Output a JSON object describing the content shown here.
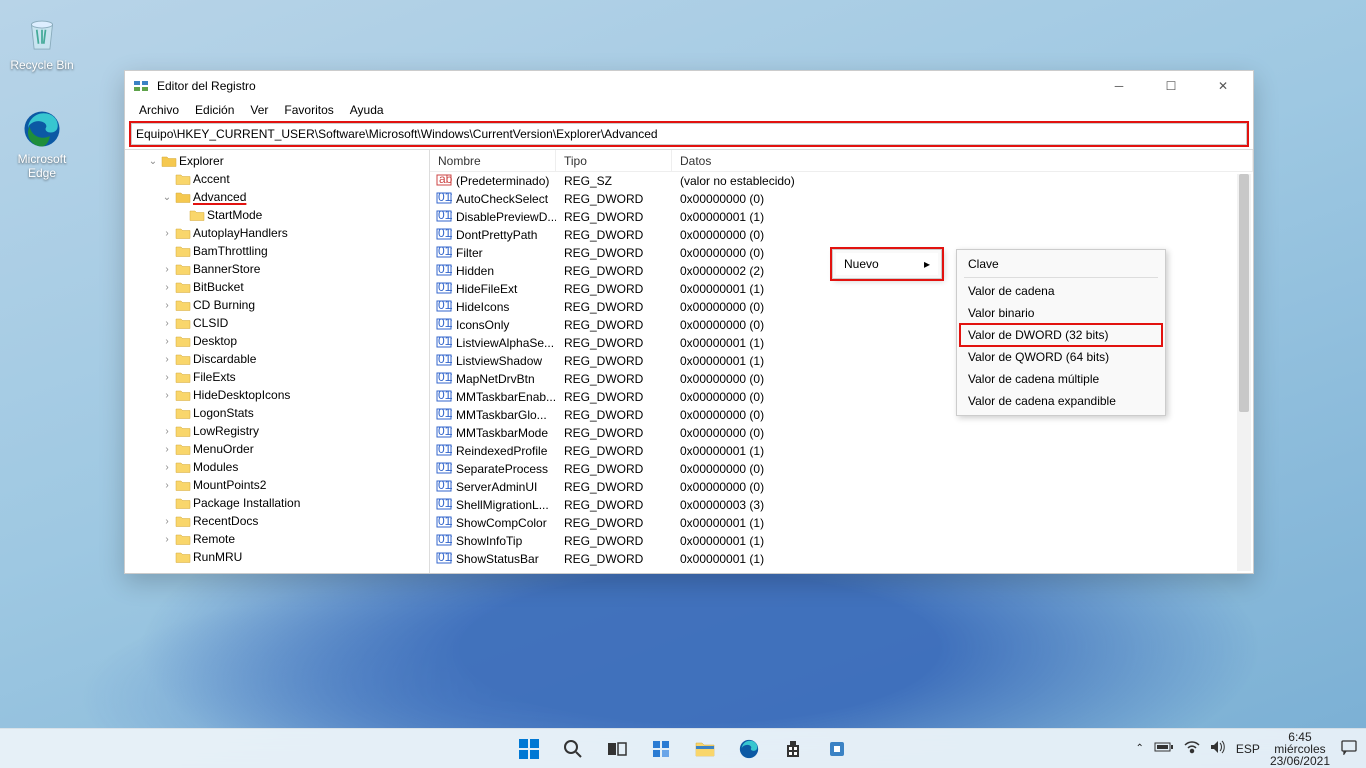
{
  "desktop": {
    "recycle_bin": "Recycle Bin",
    "edge": "Microsoft Edge"
  },
  "window": {
    "title": "Editor del Registro",
    "menu": [
      "Archivo",
      "Edición",
      "Ver",
      "Favoritos",
      "Ayuda"
    ],
    "address": "Equipo\\HKEY_CURRENT_USER\\Software\\Microsoft\\Windows\\CurrentVersion\\Explorer\\Advanced",
    "columns": {
      "name": "Nombre",
      "type": "Tipo",
      "data": "Datos"
    },
    "tree": [
      {
        "indent": 8,
        "exp": "open",
        "label": "Explorer",
        "chev": "down"
      },
      {
        "indent": 9,
        "exp": "closed",
        "label": "Accent",
        "chev": ""
      },
      {
        "indent": 9,
        "exp": "open",
        "label": "Advanced",
        "chev": "down",
        "sel": true
      },
      {
        "indent": 10,
        "exp": "closed",
        "label": "StartMode",
        "chev": ""
      },
      {
        "indent": 9,
        "exp": "closed",
        "label": "AutoplayHandlers",
        "chev": "right"
      },
      {
        "indent": 9,
        "exp": "closed",
        "label": "BamThrottling",
        "chev": ""
      },
      {
        "indent": 9,
        "exp": "closed",
        "label": "BannerStore",
        "chev": "right"
      },
      {
        "indent": 9,
        "exp": "closed",
        "label": "BitBucket",
        "chev": "right"
      },
      {
        "indent": 9,
        "exp": "closed",
        "label": "CD Burning",
        "chev": "right"
      },
      {
        "indent": 9,
        "exp": "closed",
        "label": "CLSID",
        "chev": "right"
      },
      {
        "indent": 9,
        "exp": "closed",
        "label": "Desktop",
        "chev": "right"
      },
      {
        "indent": 9,
        "exp": "closed",
        "label": "Discardable",
        "chev": "right"
      },
      {
        "indent": 9,
        "exp": "closed",
        "label": "FileExts",
        "chev": "right"
      },
      {
        "indent": 9,
        "exp": "closed",
        "label": "HideDesktopIcons",
        "chev": "right"
      },
      {
        "indent": 9,
        "exp": "closed",
        "label": "LogonStats",
        "chev": ""
      },
      {
        "indent": 9,
        "exp": "closed",
        "label": "LowRegistry",
        "chev": "right"
      },
      {
        "indent": 9,
        "exp": "closed",
        "label": "MenuOrder",
        "chev": "right"
      },
      {
        "indent": 9,
        "exp": "closed",
        "label": "Modules",
        "chev": "right"
      },
      {
        "indent": 9,
        "exp": "closed",
        "label": "MountPoints2",
        "chev": "right"
      },
      {
        "indent": 9,
        "exp": "closed",
        "label": "Package Installation",
        "chev": ""
      },
      {
        "indent": 9,
        "exp": "closed",
        "label": "RecentDocs",
        "chev": "right"
      },
      {
        "indent": 9,
        "exp": "closed",
        "label": "Remote",
        "chev": "right"
      },
      {
        "indent": 9,
        "exp": "closed",
        "label": "RunMRU",
        "chev": ""
      }
    ],
    "rows": [
      {
        "icon": "str",
        "name": "(Predeterminado)",
        "type": "REG_SZ",
        "data": "(valor no establecido)"
      },
      {
        "icon": "dw",
        "name": "AutoCheckSelect",
        "type": "REG_DWORD",
        "data": "0x00000000 (0)"
      },
      {
        "icon": "dw",
        "name": "DisablePreviewD...",
        "type": "REG_DWORD",
        "data": "0x00000001 (1)"
      },
      {
        "icon": "dw",
        "name": "DontPrettyPath",
        "type": "REG_DWORD",
        "data": "0x00000000 (0)"
      },
      {
        "icon": "dw",
        "name": "Filter",
        "type": "REG_DWORD",
        "data": "0x00000000 (0)"
      },
      {
        "icon": "dw",
        "name": "Hidden",
        "type": "REG_DWORD",
        "data": "0x00000002 (2)"
      },
      {
        "icon": "dw",
        "name": "HideFileExt",
        "type": "REG_DWORD",
        "data": "0x00000001 (1)"
      },
      {
        "icon": "dw",
        "name": "HideIcons",
        "type": "REG_DWORD",
        "data": "0x00000000 (0)"
      },
      {
        "icon": "dw",
        "name": "IconsOnly",
        "type": "REG_DWORD",
        "data": "0x00000000 (0)"
      },
      {
        "icon": "dw",
        "name": "ListviewAlphaSe...",
        "type": "REG_DWORD",
        "data": "0x00000001 (1)"
      },
      {
        "icon": "dw",
        "name": "ListviewShadow",
        "type": "REG_DWORD",
        "data": "0x00000001 (1)"
      },
      {
        "icon": "dw",
        "name": "MapNetDrvBtn",
        "type": "REG_DWORD",
        "data": "0x00000000 (0)"
      },
      {
        "icon": "dw",
        "name": "MMTaskbarEnab...",
        "type": "REG_DWORD",
        "data": "0x00000000 (0)"
      },
      {
        "icon": "dw",
        "name": "MMTaskbarGlo...",
        "type": "REG_DWORD",
        "data": "0x00000000 (0)"
      },
      {
        "icon": "dw",
        "name": "MMTaskbarMode",
        "type": "REG_DWORD",
        "data": "0x00000000 (0)"
      },
      {
        "icon": "dw",
        "name": "ReindexedProfile",
        "type": "REG_DWORD",
        "data": "0x00000001 (1)"
      },
      {
        "icon": "dw",
        "name": "SeparateProcess",
        "type": "REG_DWORD",
        "data": "0x00000000 (0)"
      },
      {
        "icon": "dw",
        "name": "ServerAdminUI",
        "type": "REG_DWORD",
        "data": "0x00000000 (0)"
      },
      {
        "icon": "dw",
        "name": "ShellMigrationL...",
        "type": "REG_DWORD",
        "data": "0x00000003 (3)"
      },
      {
        "icon": "dw",
        "name": "ShowCompColor",
        "type": "REG_DWORD",
        "data": "0x00000001 (1)"
      },
      {
        "icon": "dw",
        "name": "ShowInfoTip",
        "type": "REG_DWORD",
        "data": "0x00000001 (1)"
      },
      {
        "icon": "dw",
        "name": "ShowStatusBar",
        "type": "REG_DWORD",
        "data": "0x00000001 (1)"
      }
    ]
  },
  "context1": {
    "nuevo": "Nuevo"
  },
  "context2": {
    "clave": "Clave",
    "cadena": "Valor de cadena",
    "binario": "Valor binario",
    "dword": "Valor de DWORD (32 bits)",
    "qword": "Valor de QWORD (64 bits)",
    "multi": "Valor de cadena múltiple",
    "expand": "Valor de cadena expandible"
  },
  "taskbar": {
    "lang": "ESP",
    "time": "6:45",
    "day": "miércoles",
    "date": "23/06/2021"
  }
}
